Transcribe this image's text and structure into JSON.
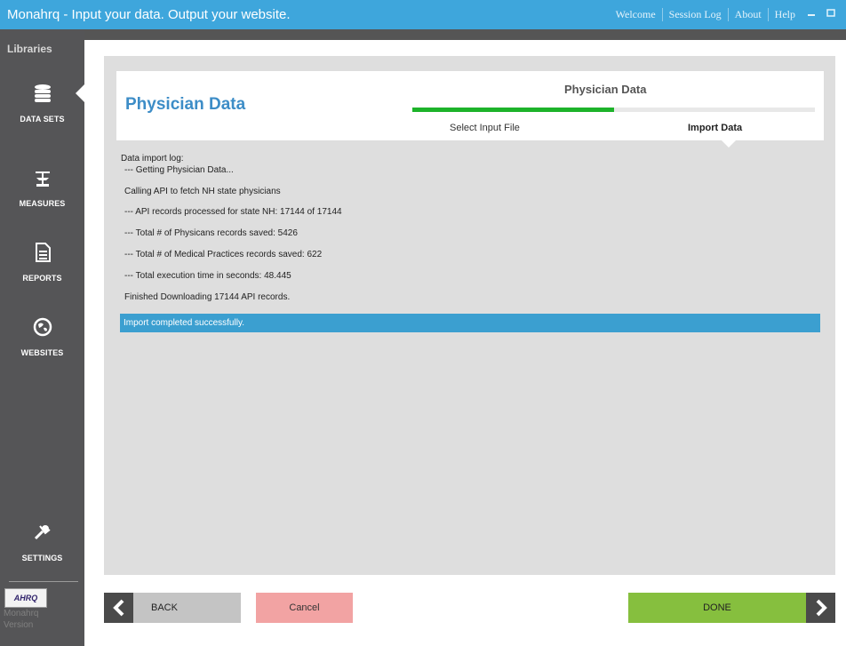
{
  "window": {
    "title": "Monahrq - Input your data. Output your website.",
    "nav": [
      "Welcome",
      "Session Log",
      "About",
      "Help"
    ],
    "minimize_icon": "minimize-icon",
    "maximize_icon": "maximize-icon"
  },
  "sidebar": {
    "title": "Libraries",
    "items": [
      {
        "label": "DATA SETS",
        "icon": "database-icon",
        "active": true
      },
      {
        "label": "MEASURES",
        "icon": "scale-icon",
        "active": false
      },
      {
        "label": "REPORTS",
        "icon": "document-icon",
        "active": false
      },
      {
        "label": "WEBSITES",
        "icon": "globe-icon",
        "active": false
      },
      {
        "label": "SETTINGS",
        "icon": "wrench-icon",
        "active": false
      }
    ],
    "logo_text": "AHRQ",
    "version": [
      "Monahrq",
      "Version"
    ]
  },
  "header": {
    "page_title": "Physician Data",
    "wizard_title": "Physician Data",
    "steps": [
      "Select Input File",
      "Import Data"
    ],
    "progress": 0.5
  },
  "log": {
    "title": "Data import log:",
    "lines": [
      "--- Getting Physician Data...",
      "Calling API to fetch NH state physicians",
      "--- API records processed for state NH: 17144 of 17144",
      "--- Total # of Physicans records saved: 5426",
      "--- Total # of Medical Practices records saved: 622",
      "--- Total execution time in seconds: 48.445",
      "Finished Downloading 17144 API records."
    ],
    "success": "Import completed successfully."
  },
  "buttons": {
    "back": "BACK",
    "cancel": "Cancel",
    "done": "DONE"
  },
  "colors": {
    "titlebar": "#3ea6dc",
    "sidebar": "#555557",
    "accent": "#3d8dc7",
    "progress": "#1db32a",
    "success_bar": "#3b9fd0",
    "cancel": "#f2a3a3",
    "done": "#86bf3e"
  }
}
